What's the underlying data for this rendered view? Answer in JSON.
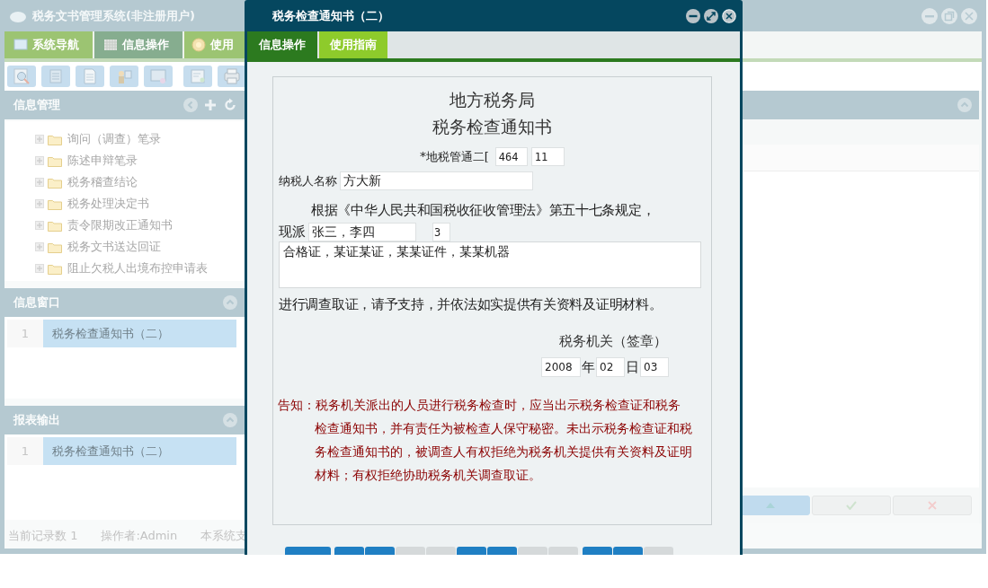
{
  "app": {
    "title": "税务文书管理系统(非注册用户)"
  },
  "nav_tabs": [
    {
      "label": "系统导航",
      "selected": false
    },
    {
      "label": "信息操作",
      "selected": true
    },
    {
      "label": "使用",
      "selected": false
    }
  ],
  "info_manage": {
    "title": "信息管理",
    "tree": [
      {
        "label": "询问（调查）笔录",
        "expanded": false
      },
      {
        "label": "陈述申辩笔录",
        "expanded": false
      },
      {
        "label": "税务稽查结论",
        "expanded": false
      },
      {
        "label": "税务处理决定书",
        "expanded": false
      },
      {
        "label": "责令限期改正通知书",
        "expanded": false
      },
      {
        "label": "税务文书送达回证",
        "expanded": false
      },
      {
        "label": "阻止欠税人出境布控申请表",
        "expanded": false
      }
    ]
  },
  "info_window": {
    "title": "信息窗口",
    "rows": [
      {
        "index": "1",
        "label": "税务检查通知书（二）",
        "selected": true
      }
    ]
  },
  "report_output": {
    "title": "报表输出",
    "rows": [
      {
        "index": "1",
        "label": "税务检查通知书（二）",
        "selected": true
      }
    ]
  },
  "status_bar": [
    "当前记录数 1",
    "操作者:Admin",
    "本系统支"
  ],
  "dialog": {
    "title": "税务检查通知书（二）",
    "tabs": [
      {
        "label": "信息操作",
        "selected": true
      },
      {
        "label": "使用指南",
        "selected": false
      }
    ],
    "form": {
      "heading": [
        "地方税务局",
        "税务检查通知书"
      ],
      "doc_number": {
        "label": "*地税管通二[",
        "fields": [
          "464",
          "11"
        ]
      },
      "taxpayer": {
        "label": "纳税人名称",
        "value": "方大新"
      },
      "basis": "根据《中华人民共和国税收征收管理法》第五十七条规定，",
      "dispatch": {
        "label": "现派",
        "names": "张三，李四",
        "field_2": "3"
      },
      "items": "合格证，某证某证，某某证件，某某机器",
      "request": "进行调查取证，请予支持，并依法如实提供有关资料及证明材料。",
      "signature": "税务机关（签章）",
      "date": [
        {
          "value": "2008",
          "unit": "年"
        },
        {
          "value": "02",
          "unit": "日"
        },
        {
          "value": "03"
        }
      ],
      "notice": "告知：税务机关派出的人员进行税务检查时，应当出示税务检查证和税务检查通知书，并有责任为被检查人保守秘密。未出示税务检查证和税务检查通知书的，被调查人有权拒绝为税务机关提供有关资料及证明材料；有权拒绝协助税务机关调查取证。"
    },
    "buttons": [
      {
        "disabled": false
      },
      {
        "disabled": false
      },
      {
        "disabled": false
      },
      {
        "disabled": true
      },
      {
        "disabled": true
      },
      {
        "disabled": false
      },
      {
        "disabled": false
      },
      {
        "disabled": true
      },
      {
        "disabled": true
      },
      {
        "disabled": false
      },
      {
        "disabled": false
      },
      {
        "disabled": true
      }
    ]
  }
}
